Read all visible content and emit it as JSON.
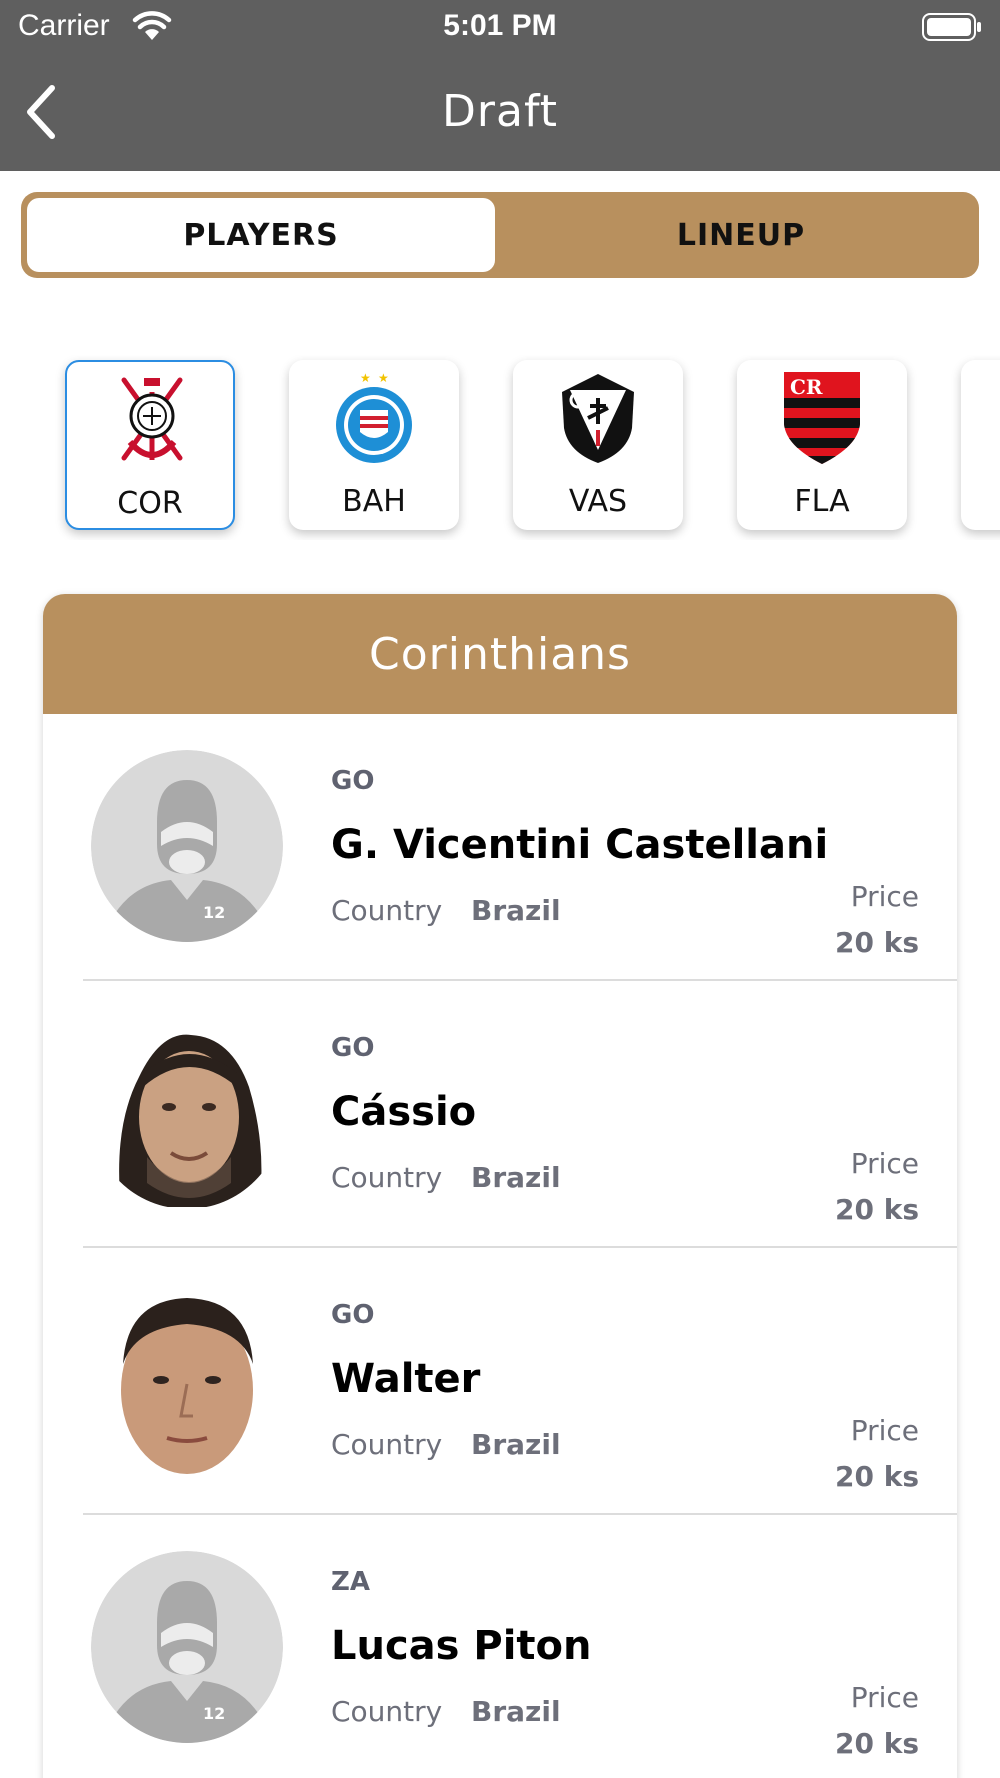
{
  "status_bar": {
    "carrier": "Carrier",
    "time": "5:01 PM",
    "icons": [
      "wifi-icon",
      "battery-icon"
    ]
  },
  "nav": {
    "title": "Draft",
    "back_icon": "chevron-left-icon"
  },
  "segments": {
    "selected": "PLAYERS",
    "items": [
      {
        "label": "PLAYERS"
      },
      {
        "label": "LINEUP"
      }
    ]
  },
  "teams": [
    {
      "code": "COR",
      "selected": true,
      "logo": "corinthians-crest"
    },
    {
      "code": "BAH",
      "selected": false,
      "logo": "bahia-crest"
    },
    {
      "code": "VAS",
      "selected": false,
      "logo": "vasco-crest"
    },
    {
      "code": "FLA",
      "selected": false,
      "logo": "flamengo-crest"
    }
  ],
  "panel": {
    "team_name": "Corinthians",
    "country_label": "Country",
    "price_label": "Price",
    "players": [
      {
        "position": "GO",
        "name": "G. Vicentini Castellani",
        "country": "Brazil",
        "price": "20 ks",
        "avatar": "placeholder-avatar"
      },
      {
        "position": "GO",
        "name": "Cássio",
        "country": "Brazil",
        "price": "20 ks",
        "avatar": "player-photo"
      },
      {
        "position": "GO",
        "name": "Walter",
        "country": "Brazil",
        "price": "20 ks",
        "avatar": "player-photo"
      },
      {
        "position": "ZA",
        "name": "Lucas Piton",
        "country": "Brazil",
        "price": "20 ks",
        "avatar": "placeholder-avatar"
      }
    ]
  },
  "colors": {
    "nav_background": "#5f5f5f",
    "accent": "#b8905e",
    "selected_border": "#2b8de2",
    "muted_text": "#6d6f7a"
  }
}
